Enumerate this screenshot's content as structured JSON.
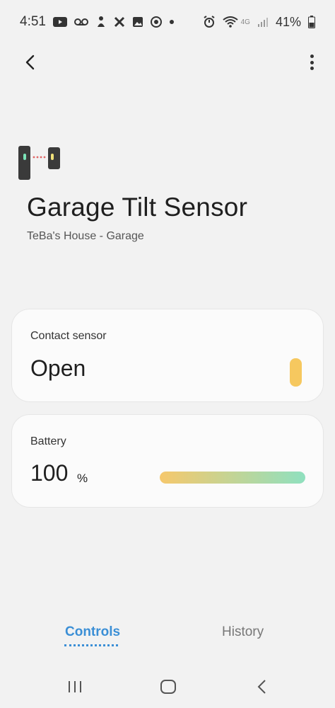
{
  "status_bar": {
    "time": "4:51",
    "battery_percent": "41%",
    "network_label": "4G",
    "icons": [
      "youtube-icon",
      "voicemail-icon",
      "notification-icon",
      "app-icon",
      "gallery-icon",
      "chrome-icon",
      "dot-icon",
      "alarm-icon",
      "wifi-icon",
      "signal-icon",
      "battery-icon"
    ]
  },
  "app_bar": {
    "back_icon": "chevron-left-icon",
    "more_icon": "more-vertical-icon"
  },
  "device": {
    "title": "Garage Tilt Sensor",
    "location": "TeBa's House - Garage",
    "icon": "tilt-sensor-icon"
  },
  "contact_card": {
    "label": "Contact sensor",
    "value": "Open",
    "indicator_color": "#f6c85f"
  },
  "battery_card": {
    "label": "Battery",
    "value": "100",
    "unit": "%",
    "level_fraction": 1.0,
    "gradient_start": "#f6c86c",
    "gradient_end": "#8fe0bf"
  },
  "tabs": {
    "controls_label": "Controls",
    "history_label": "History",
    "active_color": "#3b8fd6"
  },
  "nav_bar": {
    "icons": [
      "recents-icon",
      "home-icon",
      "back-icon"
    ]
  }
}
